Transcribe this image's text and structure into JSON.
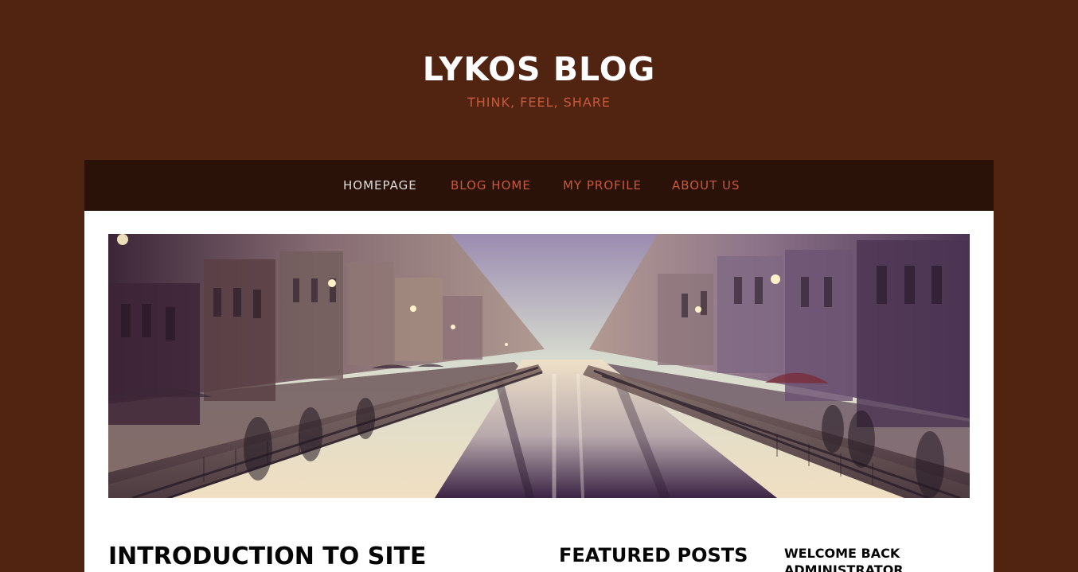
{
  "header": {
    "title": "LYKOS BLOG",
    "tagline": "THINK, FEEL, SHARE"
  },
  "navigation": {
    "items": [
      {
        "label": "HOMEPAGE",
        "state": "active"
      },
      {
        "label": "BLOG HOME",
        "state": "default"
      },
      {
        "label": "MY PROFILE",
        "state": "default"
      },
      {
        "label": "ABOUT US",
        "state": "default"
      }
    ]
  },
  "hero": {
    "icon": "canal-city-banner-image"
  },
  "main": {
    "intro_title": "INTRODUCTION TO SITE"
  },
  "sidebar": {
    "featured_title": "FEATURED POSTS",
    "welcome_line_1": "WELCOME BACK",
    "welcome_line_2": "ADMINISTRATOR"
  },
  "theme": {
    "background": "#512412",
    "nav_background": "#2a1208",
    "accent": "#c9583c",
    "content_background": "#ffffff",
    "heading_color": "#050505"
  }
}
